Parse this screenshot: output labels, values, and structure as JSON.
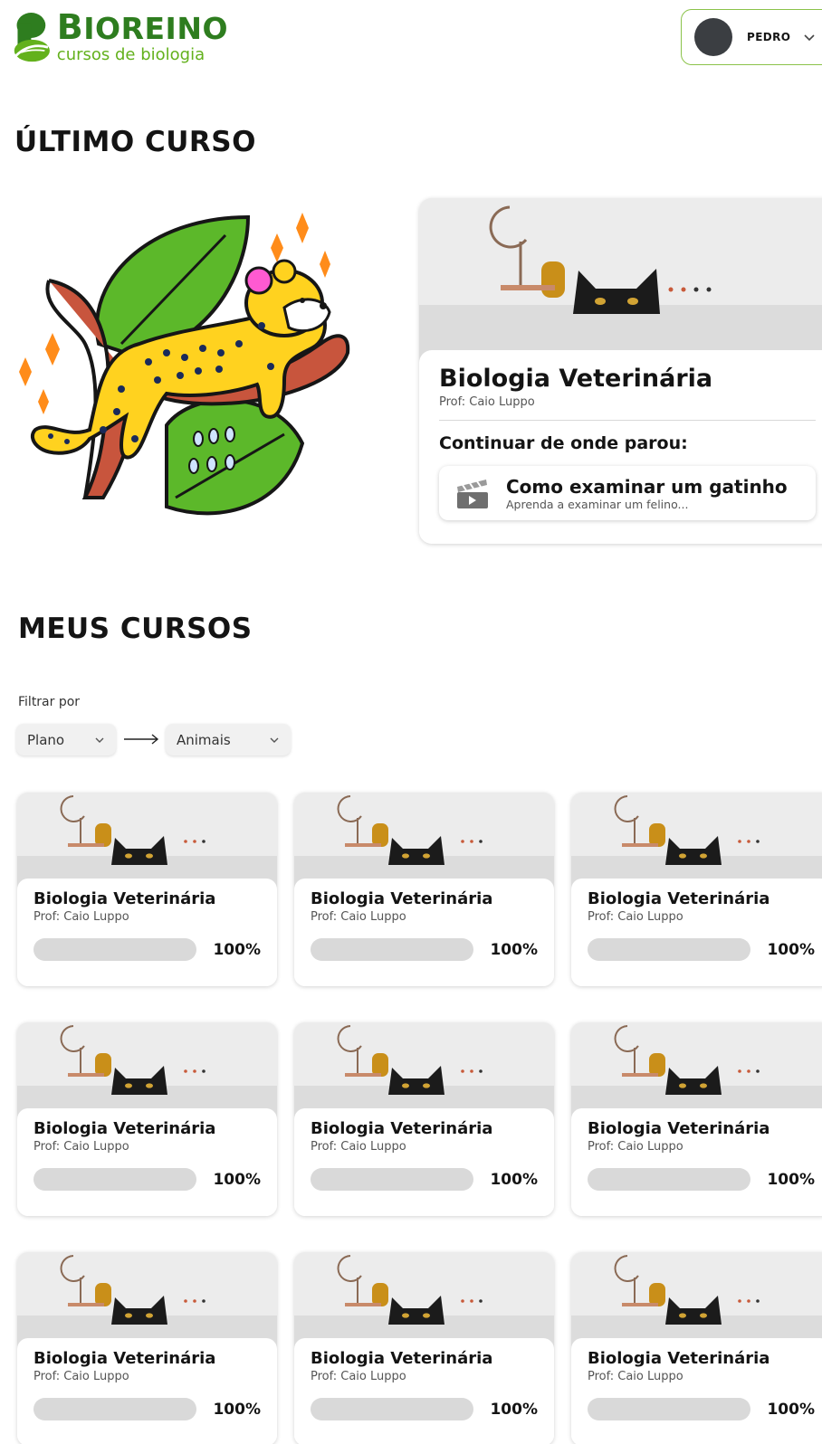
{
  "brand": {
    "initial": "B",
    "name_rest": "IOREINO",
    "tagline": "cursos de biologia"
  },
  "user": {
    "name": "PEDRO"
  },
  "last_course_section": {
    "heading": "ÚLTIMO CURSO",
    "course": {
      "title": "Biologia Veterinária",
      "professor": "Prof: Caio Luppo",
      "continue_label": "Continuar de onde parou:",
      "lesson": {
        "title": "Como examinar um gatinho",
        "subtitle": "Aprenda a examinar um felino..."
      }
    }
  },
  "my_courses_section": {
    "heading": "MEUS CURSOS",
    "filter_label": "Filtrar por",
    "filter_plan": "Plano",
    "filter_category": "Animais",
    "courses": [
      {
        "title": "Biologia Veterinária",
        "professor": "Prof: Caio Luppo",
        "progress_label": "100%",
        "progress": 1.0
      },
      {
        "title": "Biologia Veterinária",
        "professor": "Prof: Caio Luppo",
        "progress_label": "100%",
        "progress": 1.0
      },
      {
        "title": "Biologia Veterinária",
        "professor": "Prof: Caio Luppo",
        "progress_label": "100%",
        "progress": 1.0
      },
      {
        "title": "Biologia Veterinária",
        "professor": "Prof: Caio Luppo",
        "progress_label": "100%",
        "progress": 1.0
      },
      {
        "title": "Biologia Veterinária",
        "professor": "Prof: Caio Luppo",
        "progress_label": "100%",
        "progress": 1.0
      },
      {
        "title": "Biologia Veterinária",
        "professor": "Prof: Caio Luppo",
        "progress_label": "100%",
        "progress": 1.0
      },
      {
        "title": "Biologia Veterinária",
        "professor": "Prof: Caio Luppo",
        "progress_label": "100%",
        "progress": 1.0
      },
      {
        "title": "Biologia Veterinária",
        "professor": "Prof: Caio Luppo",
        "progress_label": "100%",
        "progress": 1.0
      },
      {
        "title": "Biologia Veterinária",
        "professor": "Prof: Caio Luppo",
        "progress_label": "100%",
        "progress": 1.0
      }
    ]
  },
  "icons": {
    "logo": "bioreino-leaf-logo",
    "user_menu": "chevron-down-icon",
    "lesson": "clapperboard-icon",
    "filter_arrow": "arrow-right-icon"
  },
  "colors": {
    "brand_green": "#2e7d1f",
    "brand_light_green": "#63b11c",
    "progress_bar": "#d9d9d9"
  }
}
